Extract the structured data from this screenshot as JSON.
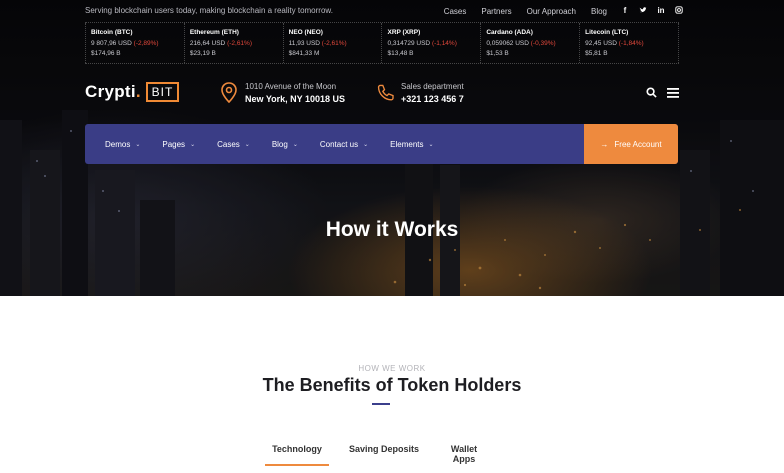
{
  "topbar": {
    "tagline": "Serving blockchain users today, making blockchain a reality tomorrow.",
    "links": [
      "Cases",
      "Partners",
      "Our Approach",
      "Blog"
    ],
    "social": [
      "facebook-icon",
      "twitter-icon",
      "linkedin-icon",
      "instagram-icon"
    ]
  },
  "ticker": [
    {
      "name": "Bitcoin (BTC)",
      "price": "9 807,96 USD",
      "change": "(-2,89%)",
      "cap": "$174,96 B"
    },
    {
      "name": "Ethereum (ETH)",
      "price": "216,64 USD",
      "change": "(-2,61%)",
      "cap": "$23,19 B"
    },
    {
      "name": "NEO (NEO)",
      "price": "11,93 USD",
      "change": "(-2,61%)",
      "cap": "$841,33 M"
    },
    {
      "name": "XRP (XRP)",
      "price": "0,314729 USD",
      "change": "(-1,14%)",
      "cap": "$13,48 B"
    },
    {
      "name": "Cardano (ADA)",
      "price": "0,059062 USD",
      "change": "(-0,39%)",
      "cap": "$1,53 B"
    },
    {
      "name": "Litecoin (LTC)",
      "price": "92,45 USD",
      "change": "(-1,84%)",
      "cap": "$5,81 B"
    }
  ],
  "brand": {
    "name": "Crypti",
    "badge": "BIT"
  },
  "address": {
    "line1": "1010 Avenue of the Moon",
    "line2": "New York, NY 10018 US"
  },
  "sales": {
    "line1": "Sales department",
    "line2": "+321 123 456 7"
  },
  "nav": {
    "items": [
      "Demos",
      "Pages",
      "Cases",
      "Blog",
      "Contact us",
      "Elements"
    ],
    "cta": "Free Account"
  },
  "hero": {
    "title": "How it Works"
  },
  "section": {
    "eyebrow": "HOW WE WORK",
    "title": "The Benefits of Token Holders",
    "tabs": [
      "Technology",
      "Saving Deposits",
      "Wallet Apps"
    ]
  },
  "colors": {
    "accent": "#ee8a3e",
    "nav": "#3a3d86",
    "negative": "#e2483b"
  }
}
